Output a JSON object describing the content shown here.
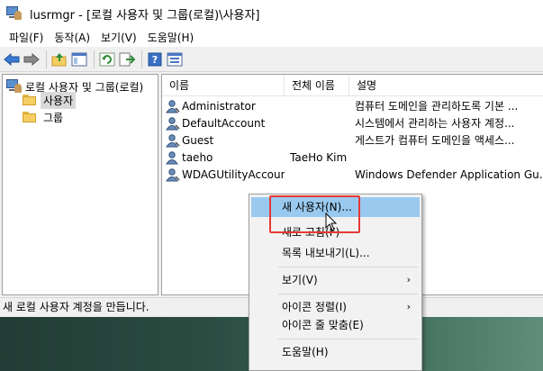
{
  "window": {
    "title": "lusrmgr - [로컬 사용자 및 그룹(로컬)\\사용자]"
  },
  "menubar": {
    "items": [
      "파일(F)",
      "동작(A)",
      "보기(V)",
      "도움말(H)"
    ]
  },
  "toolbar": {
    "icons": [
      "back-arrow-icon",
      "forward-arrow-icon",
      "up-folder-icon",
      "show-hide-tree-icon",
      "refresh-icon",
      "export-list-icon",
      "help-icon",
      "properties-icon"
    ]
  },
  "tree": {
    "root": "로컬 사용자 및 그룹(로컬)",
    "children": [
      "사용자",
      "그룹"
    ],
    "selected": "사용자"
  },
  "list": {
    "columns": [
      "이름",
      "전체 이름",
      "설명"
    ],
    "rows": [
      {
        "name": "Administrator",
        "full_name": "",
        "description": "컴퓨터 도메인을 관리하도록 기본 ..."
      },
      {
        "name": "DefaultAccount",
        "full_name": "",
        "description": "시스템에서 관리하는 사용자 계정..."
      },
      {
        "name": "Guest",
        "full_name": "",
        "description": "게스트가 컴퓨터 도메인을 액세스..."
      },
      {
        "name": "taeho",
        "full_name": "TaeHo Kim",
        "description": ""
      },
      {
        "name": "WDAGUtilityAccount",
        "full_name": "",
        "description": "Windows Defender Application Gu..."
      }
    ]
  },
  "status": {
    "text": "새 로컬 사용자 계정을 만듭니다."
  },
  "context_menu": {
    "items": [
      {
        "label": "새 사용자(N)...",
        "hover": true
      },
      {
        "label": "새로 고침(F)"
      },
      {
        "label": "목록 내보내기(L)..."
      },
      {
        "label": "보기(V)",
        "submenu": true
      },
      {
        "label": "아이콘 정렬(I)",
        "submenu": true
      },
      {
        "label": "아이콘 줄 맞춤(E)"
      },
      {
        "label": "도움말(H)"
      }
    ],
    "submenu_arrow": "›"
  },
  "colors": {
    "hover": "#99c9ef",
    "highlight": "#e53935"
  }
}
